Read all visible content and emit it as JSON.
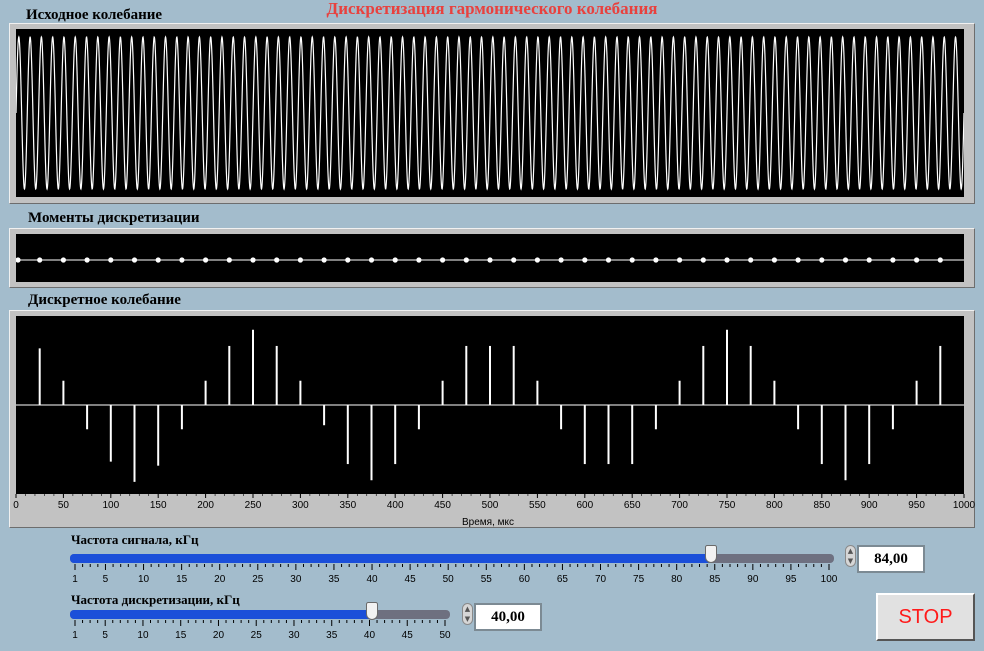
{
  "title": "Дискретизация гармонического колебания",
  "graphs": {
    "source": {
      "label": "Исходное колебание"
    },
    "moments": {
      "label": "Моменты дискретизации"
    },
    "discrete": {
      "label": "Дискретное колебание",
      "x_axis_label": "Время, мкс"
    }
  },
  "controls": {
    "signal_freq": {
      "label": "Частота сигнала, кГц",
      "value": "84,00",
      "value_num": 84,
      "min": 1,
      "max": 100,
      "ticks": [
        "1",
        "5",
        "10",
        "15",
        "20",
        "25",
        "30",
        "35",
        "40",
        "45",
        "50",
        "55",
        "60",
        "65",
        "70",
        "75",
        "80",
        "85",
        "90",
        "95",
        "100"
      ]
    },
    "sample_freq": {
      "label": "Частота дискретизации, кГц",
      "value": "40,00",
      "value_num": 40,
      "min": 1,
      "max": 50,
      "ticks": [
        "1",
        "5",
        "10",
        "15",
        "20",
        "25",
        "30",
        "35",
        "40",
        "45",
        "50"
      ]
    },
    "stop_label": "STOP"
  },
  "chart_data": [
    {
      "type": "line",
      "title": "Исходное колебание",
      "description_note": "sine wave, frequency 84 kHz over 0..1000 µs",
      "frequency_khz": 84,
      "x_range": [
        0,
        1000
      ],
      "y_range": [
        -1,
        1
      ],
      "grid": false
    },
    {
      "type": "scatter",
      "title": "Моменты дискретизации",
      "x": [
        0,
        25,
        50,
        75,
        100,
        125,
        150,
        175,
        200,
        225,
        250,
        275,
        300,
        325,
        350,
        375,
        400,
        425,
        450,
        475,
        500,
        525,
        550,
        575,
        600,
        625,
        650,
        675,
        700,
        725,
        750,
        775,
        800,
        825,
        850,
        875,
        900,
        925,
        950,
        975
      ],
      "y": [
        0,
        0,
        0,
        0,
        0,
        0,
        0,
        0,
        0,
        0,
        0,
        0,
        0,
        0,
        0,
        0,
        0,
        0,
        0,
        0,
        0,
        0,
        0,
        0,
        0,
        0,
        0,
        0,
        0,
        0,
        0,
        0,
        0,
        0,
        0,
        0,
        0,
        0,
        0,
        0
      ],
      "x_range": [
        0,
        1000
      ]
    },
    {
      "type": "bar",
      "title": "Дискретное колебание",
      "xlabel": "Время, мкс",
      "x": [
        0,
        25,
        50,
        75,
        100,
        125,
        150,
        175,
        200,
        225,
        250,
        275,
        300,
        325,
        350,
        375,
        400,
        425,
        450,
        475,
        500,
        525,
        550,
        575,
        600,
        625,
        650,
        675,
        700,
        725,
        750,
        775,
        800,
        825,
        850,
        875,
        900,
        925,
        950,
        975
      ],
      "values": [
        0,
        0.7,
        0.3,
        -0.3,
        -0.7,
        -0.95,
        -0.75,
        -0.3,
        0.3,
        0.73,
        0.93,
        0.73,
        0.3,
        -0.25,
        -0.73,
        -0.93,
        -0.73,
        -0.3,
        0.3,
        0.73,
        0.73,
        0.73,
        0.3,
        -0.3,
        -0.73,
        -0.73,
        -0.73,
        -0.3,
        0.3,
        0.73,
        0.93,
        0.73,
        0.3,
        -0.3,
        -0.73,
        -0.93,
        -0.73,
        -0.3,
        0.3,
        0.73
      ],
      "x_range": [
        0,
        1000
      ],
      "y_range": [
        -1.1,
        1.1
      ],
      "xticks": [
        "0",
        "50",
        "100",
        "150",
        "200",
        "250",
        "300",
        "350",
        "400",
        "450",
        "500",
        "550",
        "600",
        "650",
        "700",
        "750",
        "800",
        "850",
        "900",
        "950",
        "1000"
      ],
      "grid": false
    }
  ]
}
